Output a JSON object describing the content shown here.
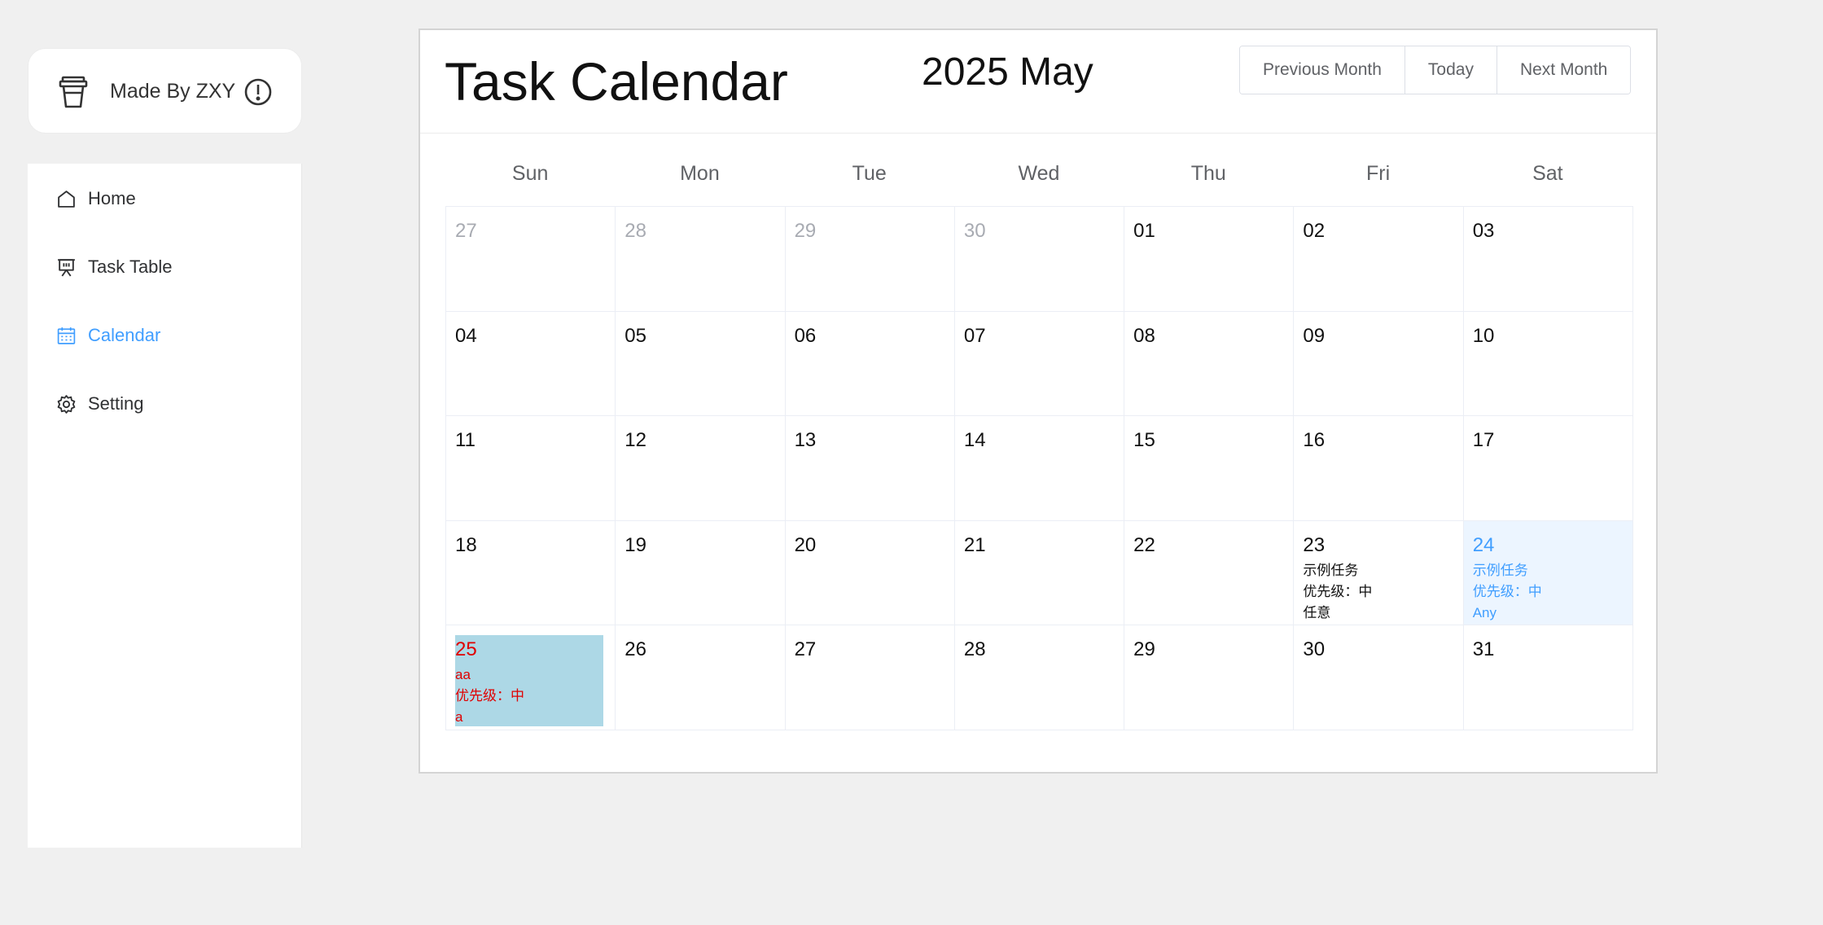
{
  "brand": {
    "label": "Made By ZXY",
    "icon": "cup-icon",
    "info_icon": "info-icon"
  },
  "menu": {
    "items": [
      {
        "label": "Home",
        "icon": "home-icon",
        "active": false
      },
      {
        "label": "Task Table",
        "icon": "presentation-icon",
        "active": false
      },
      {
        "label": "Calendar",
        "icon": "calendar-icon",
        "active": true
      },
      {
        "label": "Setting",
        "icon": "gear-icon",
        "active": false
      }
    ],
    "active_color": "#409eff"
  },
  "calendar": {
    "title": "Task Calendar",
    "month_label": "2025 May",
    "buttons": {
      "prev": "Previous Month",
      "today": "Today",
      "next": "Next Month"
    },
    "weekdays": [
      "Sun",
      "Mon",
      "Tue",
      "Wed",
      "Thu",
      "Fri",
      "Sat"
    ],
    "weeks": [
      [
        {
          "day": "27",
          "type": "prev"
        },
        {
          "day": "28",
          "type": "prev"
        },
        {
          "day": "29",
          "type": "prev"
        },
        {
          "day": "30",
          "type": "prev"
        },
        {
          "day": "01"
        },
        {
          "day": "02"
        },
        {
          "day": "03"
        }
      ],
      [
        {
          "day": "04"
        },
        {
          "day": "05"
        },
        {
          "day": "06"
        },
        {
          "day": "07"
        },
        {
          "day": "08"
        },
        {
          "day": "09"
        },
        {
          "day": "10"
        }
      ],
      [
        {
          "day": "11"
        },
        {
          "day": "12"
        },
        {
          "day": "13"
        },
        {
          "day": "14"
        },
        {
          "day": "15"
        },
        {
          "day": "16"
        },
        {
          "day": "17"
        }
      ],
      [
        {
          "day": "18"
        },
        {
          "day": "19"
        },
        {
          "day": "20"
        },
        {
          "day": "21"
        },
        {
          "day": "22"
        },
        {
          "day": "23",
          "tasks": [
            "示例任务",
            "优先级：中",
            "任意"
          ]
        },
        {
          "day": "24",
          "type": "selected",
          "tasks": [
            "示例任务",
            "优先级：中",
            "Any"
          ]
        }
      ],
      [
        {
          "day": "25",
          "type": "today",
          "tasks": [
            "aa",
            "优先级：中",
            "a"
          ]
        },
        {
          "day": "26"
        },
        {
          "day": "27"
        },
        {
          "day": "28"
        },
        {
          "day": "29"
        },
        {
          "day": "30"
        },
        {
          "day": "31"
        }
      ]
    ],
    "colors": {
      "selected_bg": "#ecf5ff",
      "today_bg": "#add8e6",
      "today_text": "#e00000",
      "prev_text": "#a8abb2"
    }
  }
}
